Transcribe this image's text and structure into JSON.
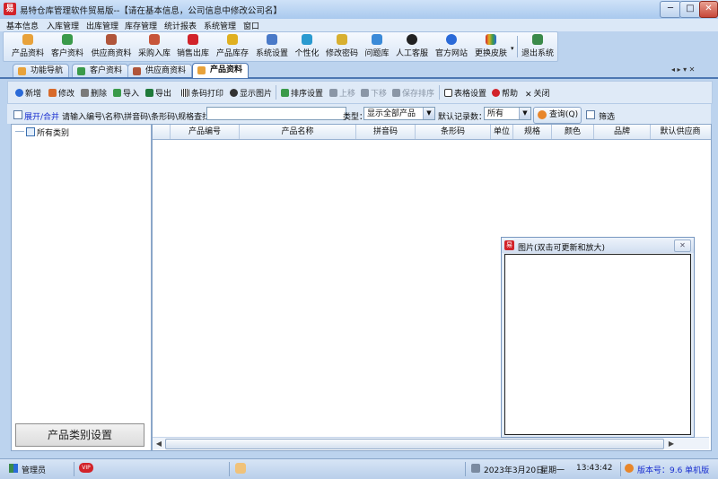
{
  "window": {
    "app_icon_text": "易",
    "title": "易特仓库管理软件贸易版--【请在基本信息，公司信息中修改公司名】",
    "min": "─",
    "max": "□",
    "close": "✕"
  },
  "menu": [
    "基本信息",
    "入库管理",
    "出库管理",
    "库存管理",
    "统计报表",
    "系统管理",
    "窗口"
  ],
  "toolbar": [
    {
      "label": "产品资料",
      "icon": "box-icon",
      "color": "#e8a23a"
    },
    {
      "label": "客户资料",
      "icon": "people-icon",
      "color": "#3a9a4a"
    },
    {
      "label": "供应商资料",
      "icon": "supplier-icon",
      "color": "#b0553a"
    },
    {
      "label": "采购入库",
      "icon": "truck-icon",
      "color": "#c7553a"
    },
    {
      "label": "销售出库",
      "icon": "basket-icon",
      "color": "#d2232a"
    },
    {
      "label": "产品库存",
      "icon": "inventory-icon",
      "color": "#e0b020"
    },
    {
      "label": "系统设置",
      "icon": "gear-icon",
      "color": "#4a7ac8"
    },
    {
      "label": "个性化",
      "icon": "personalize-icon",
      "color": "#2a9ad0"
    },
    {
      "label": "修改密码",
      "icon": "key-icon",
      "color": "#d8b030"
    },
    {
      "label": "问题库",
      "icon": "question-icon",
      "color": "#3a8ad8"
    },
    {
      "label": "人工客服",
      "icon": "qq-icon",
      "color": "#222222"
    },
    {
      "label": "官方网站",
      "icon": "ie-icon",
      "color": "#2a6ad8"
    },
    {
      "label": "更换皮肤",
      "icon": "skin-icon",
      "color": "#a84ac8"
    },
    {
      "label": "退出系统",
      "icon": "exit-icon",
      "color": "#3a8a4a"
    }
  ],
  "tabs": [
    {
      "label": "功能导航",
      "color": "#e8a23a",
      "active": false
    },
    {
      "label": "客户资料",
      "color": "#3a9a4a",
      "active": false
    },
    {
      "label": "供应商资料",
      "color": "#b0553a",
      "active": false
    },
    {
      "label": "产品资料",
      "color": "#e8a23a",
      "active": true
    }
  ],
  "tab_nav": "◂ ▸ ▾ ✕",
  "actions": [
    {
      "label": "新增",
      "icon": "add-icon",
      "color": "#2a6ad8",
      "enabled": true
    },
    {
      "label": "修改",
      "icon": "edit-icon",
      "color": "#d86a2a",
      "enabled": true
    },
    {
      "label": "删除",
      "icon": "trash-icon",
      "color": "#7a7a7a",
      "enabled": true
    },
    {
      "label": "导入",
      "icon": "import-icon",
      "color": "#3a9a4a",
      "enabled": true
    },
    {
      "label": "导出",
      "icon": "excel-icon",
      "color": "#1f7a3a",
      "enabled": true
    },
    {
      "label": "条码打印",
      "icon": "barcode-icon",
      "color": "#333333",
      "enabled": true
    },
    {
      "label": "显示图片",
      "icon": "eye-icon",
      "color": "#333333",
      "enabled": true
    },
    {
      "label": "排序设置",
      "icon": "sort-icon",
      "color": "#3a9a4a",
      "enabled": true
    },
    {
      "label": "上移",
      "icon": "up-arrow-icon",
      "color": "#8a96a6",
      "enabled": false
    },
    {
      "label": "下移",
      "icon": "down-arrow-icon",
      "color": "#8a96a6",
      "enabled": false
    },
    {
      "label": "保存排序",
      "icon": "save-icon",
      "color": "#8a96a6",
      "enabled": false
    },
    {
      "label": "表格设置",
      "icon": "table-icon",
      "color": "#333333",
      "enabled": true
    },
    {
      "label": "帮助",
      "icon": "help-icon",
      "color": "#d2232a",
      "enabled": true
    },
    {
      "label": "关闭",
      "icon": "close-icon",
      "color": "#333333",
      "enabled": true
    }
  ],
  "search": {
    "expand_label": "展开/合并",
    "hint": "请输入编号\\名称\\拼音码\\条形码\\规格查找：",
    "query_value": "",
    "type_label": "类型：",
    "type_value": "显示全部产品",
    "records_label": "默认记录数：",
    "records_value": "所有",
    "query_button": "查询(Q)",
    "filter_label": "筛选"
  },
  "tree": {
    "root": "所有类别"
  },
  "category_settings_button": "产品类别设置",
  "grid": {
    "columns": [
      "",
      "产品编号",
      "产品名称",
      "拼音码",
      "条形码",
      "单位",
      "规格",
      "颜色",
      "品牌",
      "默认供应商"
    ],
    "rows": []
  },
  "image_panel": {
    "icon_text": "易",
    "title": "图片(双击可更新和放大)",
    "close": "✕"
  },
  "status": {
    "user": "管理员",
    "vip": "VIP",
    "date": "2023年3月20日",
    "weekday": "星期一",
    "time": "13:43:42",
    "version": "版本号：9.6 单机版"
  }
}
